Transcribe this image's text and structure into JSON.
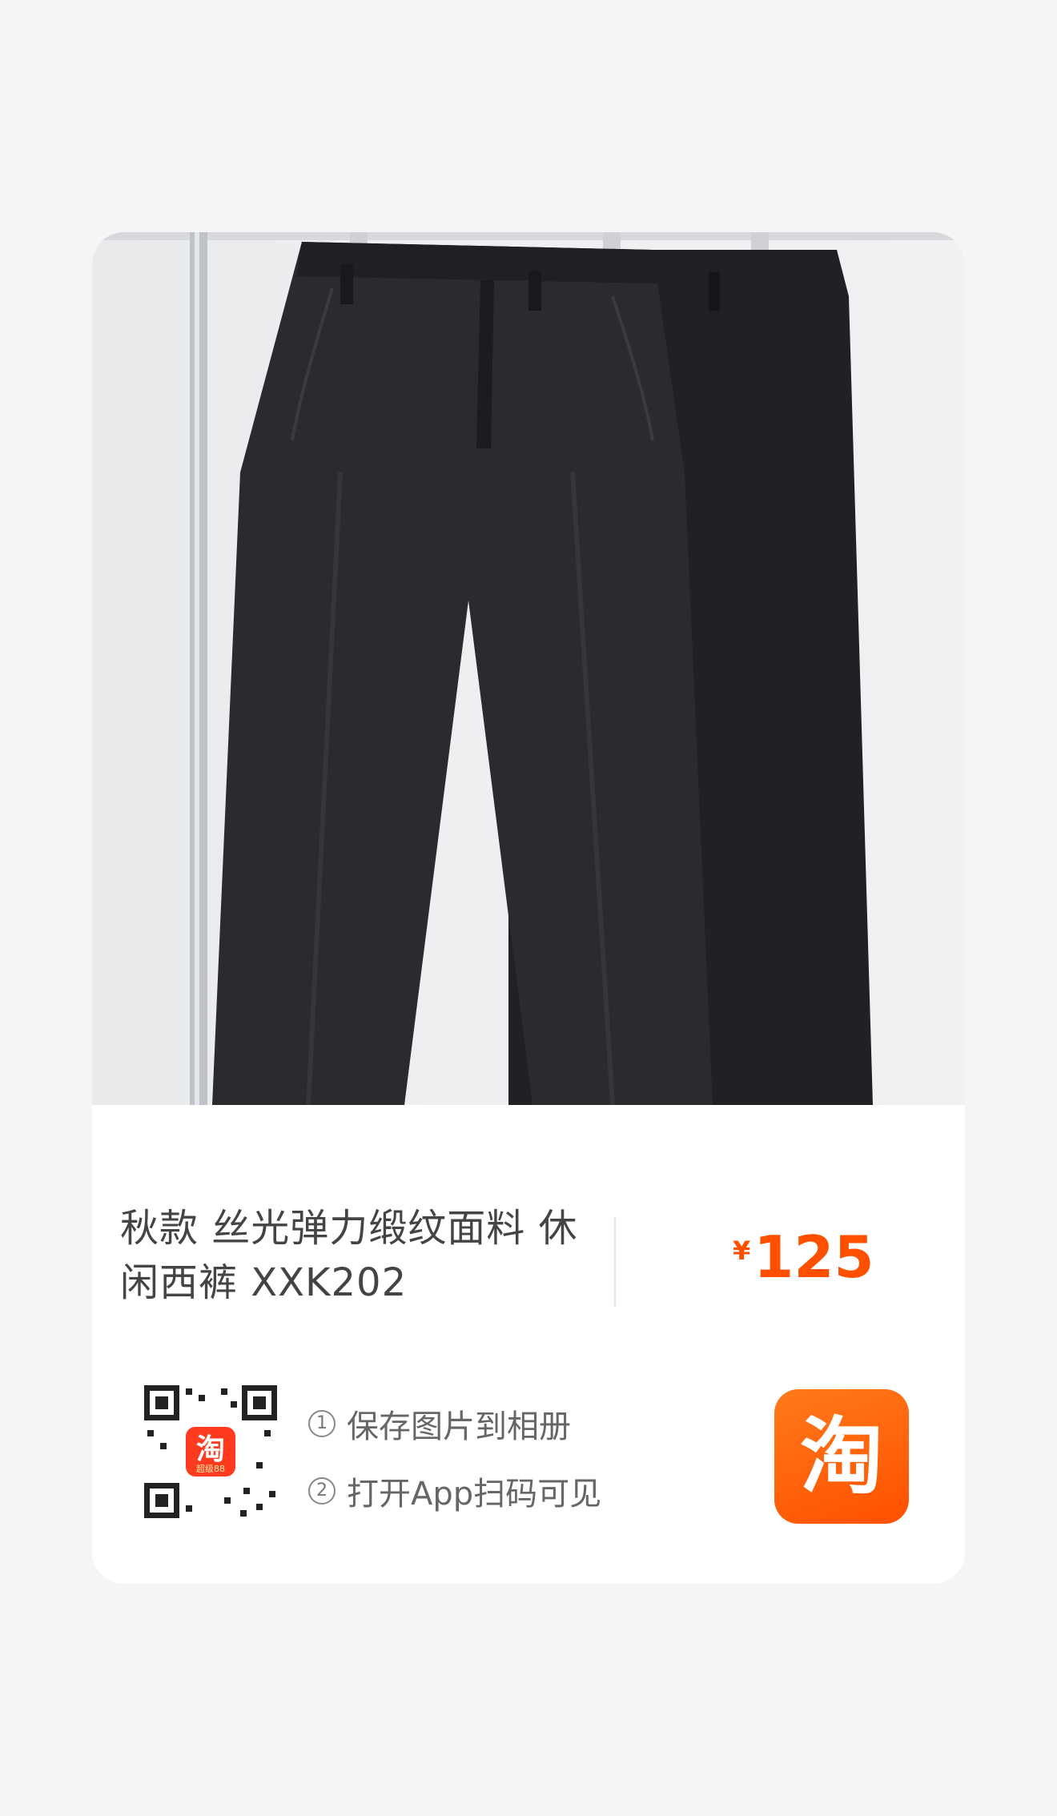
{
  "product": {
    "title": "秋款 丝光弹力缎纹面料 休闲西裤 XXK202",
    "currency_symbol": "¥",
    "price": "125",
    "image_icon": "product-photo-black-trousers"
  },
  "share": {
    "qr_icon": "qr-code-icon",
    "qr_badge_text": "淘",
    "qr_badge_sub": "超级88",
    "steps": [
      {
        "num": "1",
        "text": "保存图片到相册"
      },
      {
        "num": "2",
        "text": "打开App扫码可见"
      }
    ],
    "logo_char": "淘"
  },
  "colors": {
    "background": "#f5f5f5",
    "card": "#ffffff",
    "price": "#ff5000",
    "logo": "#ff5000",
    "title_text": "#444444",
    "step_text": "#666666"
  }
}
